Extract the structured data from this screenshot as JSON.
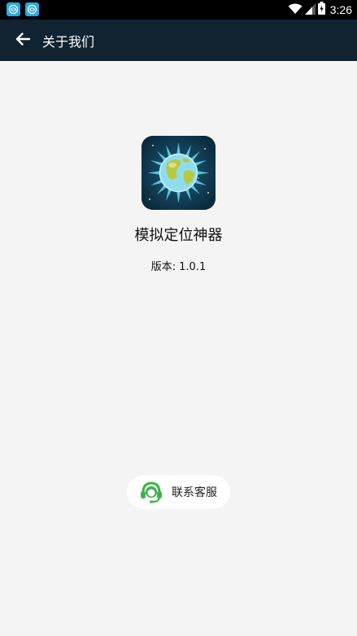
{
  "status_bar": {
    "time": "3:26",
    "notification_icons": [
      "app-notification-icon",
      "app-notification-icon"
    ],
    "icons": [
      "wifi-icon",
      "signal-icon",
      "battery-icon"
    ]
  },
  "app_bar": {
    "back_icon": "arrow-left-icon",
    "title": "关于我们"
  },
  "about": {
    "logo_icon": "globe-app-logo",
    "app_name": "模拟定位神器",
    "version_label": "版本:",
    "version_value": "1.0.1"
  },
  "contact": {
    "icon": "headset-icon",
    "label": "联系客服"
  },
  "colors": {
    "status_bar": "#000000",
    "app_bar": "#112331",
    "background": "#f4f4f4",
    "accent_green": "#3bb54a"
  }
}
